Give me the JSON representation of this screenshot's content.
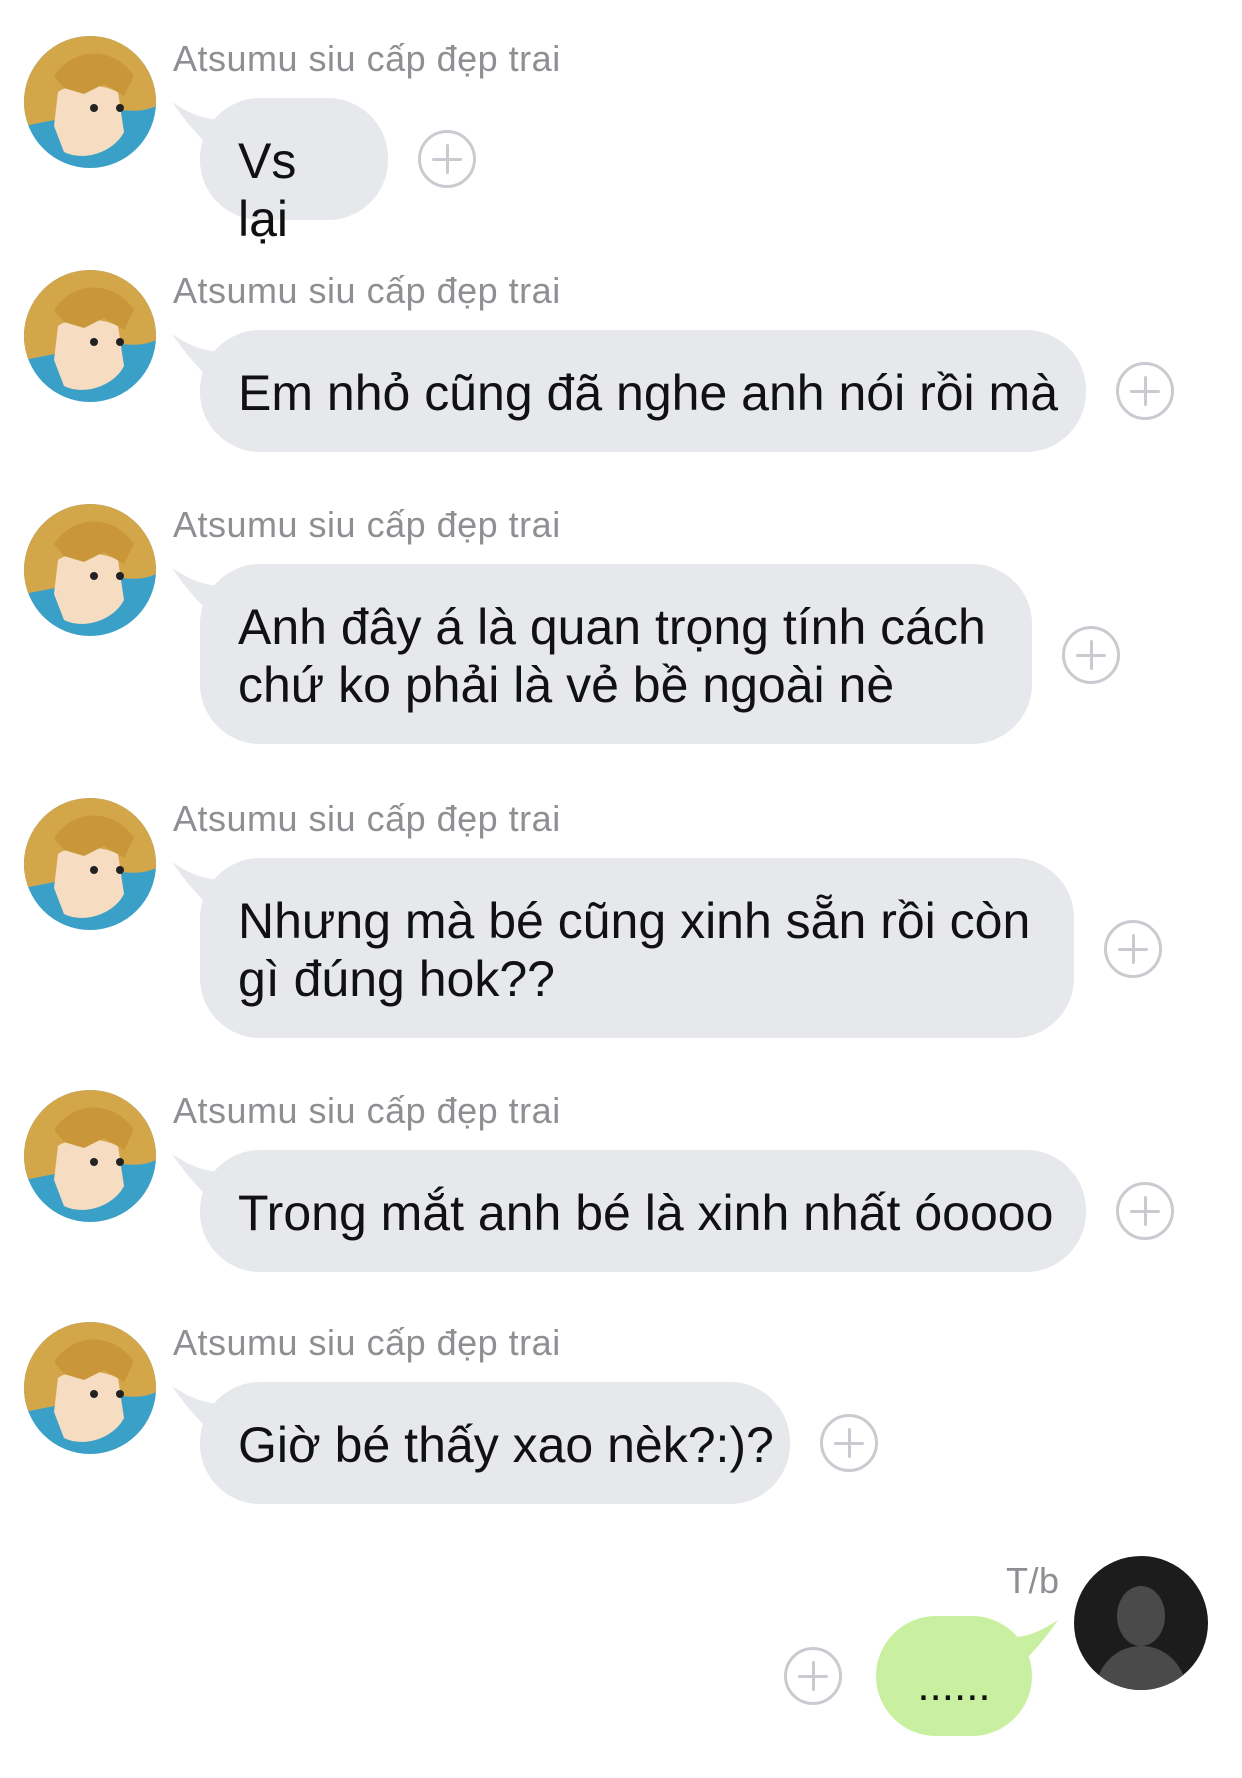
{
  "conversation": {
    "messages": [
      {
        "sender": "Atsumu siu cấp đẹp trai",
        "text": "Vs lại"
      },
      {
        "sender": "Atsumu siu cấp đẹp trai",
        "text": "Em nhỏ cũng đã nghe anh nói rồi mà"
      },
      {
        "sender": "Atsumu siu cấp đẹp trai",
        "text": "Anh đây á là quan trọng tính cách chứ ko phải là vẻ bề ngoài nè"
      },
      {
        "sender": "Atsumu siu cấp đẹp trai",
        "text": "Nhưng mà bé cũng xinh sẵn rồi còn gì đúng hok??"
      },
      {
        "sender": "Atsumu siu cấp đẹp trai",
        "text": "Trong mắt anh bé là xinh nhất óoooo"
      },
      {
        "sender": "Atsumu siu cấp đẹp trai",
        "text": "Giờ bé thấy xao nèk?:)?"
      }
    ],
    "reply": {
      "sender": "T/b",
      "text": "......"
    }
  },
  "icons": {
    "add_reaction": "plus-circle-icon",
    "default_avatar": "person-silhouette-icon"
  },
  "colors": {
    "incoming_bubble": "#e6e8ec",
    "outgoing_bubble": "#c8f0a0",
    "sender_text": "#8e8e93"
  }
}
